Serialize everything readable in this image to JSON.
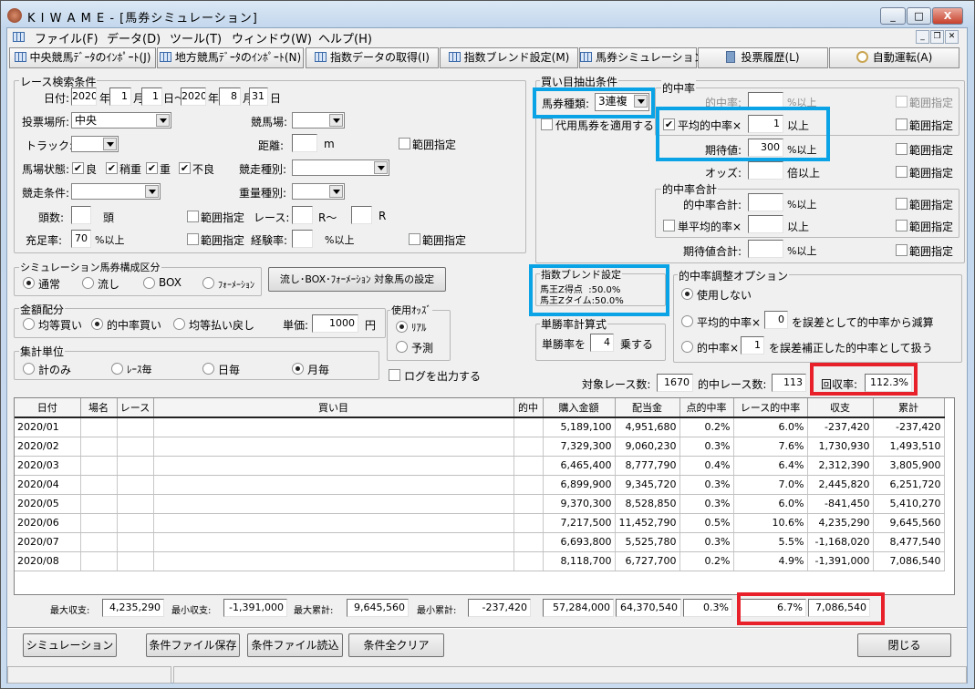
{
  "window": {
    "title": "K I W A M E - [馬券シミュレーション]",
    "controls": [
      "_",
      "□",
      "X"
    ]
  },
  "menu": [
    "ファイル(F)",
    "データ(D)",
    "ツール(T)",
    "ウィンドウ(W)",
    "ヘルプ(H)"
  ],
  "toolbar": [
    {
      "label": "中央競馬ﾃﾞｰﾀのｲﾝﾎﾟｰﾄ(J)",
      "icon": "grid-icon"
    },
    {
      "label": "地方競馬ﾃﾞｰﾀのｲﾝﾎﾟｰﾄ(N)",
      "icon": "grid-icon"
    },
    {
      "label": "指数データの取得(I)",
      "icon": "grid-icon"
    },
    {
      "label": "指数ブレンド設定(M)",
      "icon": "grid-icon"
    },
    {
      "label": "馬券シミュレーション(B)",
      "icon": "grid-icon"
    },
    {
      "label": "投票履歴(L)",
      "icon": "calculator-icon"
    },
    {
      "label": "自動運転(A)",
      "icon": "clock-icon"
    }
  ],
  "race": {
    "title": "レース検索条件",
    "date_label": "日付:",
    "from_year": "2020",
    "year": "年",
    "from_month": "1",
    "month": "月",
    "from_day": "1",
    "day_tilde": "日～",
    "to_year": "2020",
    "to_month": "8",
    "to_day": "31",
    "day": "日",
    "venue_label": "投票場所:",
    "venue": "中央",
    "track_label": "競馬場:",
    "track": "",
    "course_label": "トラック:",
    "distance_label": "距離:",
    "distance_unit": "m",
    "range": "範囲指定",
    "condition_label": "馬場状態:",
    "conditions": [
      {
        "label": "良",
        "checked": true
      },
      {
        "label": "稍重",
        "checked": true
      },
      {
        "label": "重",
        "checked": true
      },
      {
        "label": "不良",
        "checked": true
      }
    ],
    "race_type_label": "競走種別:",
    "race_cond_label": "競走条件:",
    "weight_label": "重量種別:",
    "heads_label": "頭数:",
    "heads_unit": "頭",
    "race_label": "レース:",
    "r_from": "R～",
    "r_to": "R",
    "fill_label": "充足率:",
    "fill": "70",
    "pct_over": "%以上",
    "exp_label": "経験率:"
  },
  "sim": {
    "title": "シミュレーション馬券構成区分",
    "options": [
      "通常",
      "流し",
      "BOX",
      "ﾌｫｰﾒｰｼｮﾝ"
    ],
    "selected": 0,
    "target_button": "流し･BOX･ﾌｫｰﾒｰｼｮﾝ 対象馬の設定"
  },
  "amount": {
    "title": "金額配分",
    "options": [
      "均等買い",
      "的中率買い",
      "均等払い戻し"
    ],
    "selected": 1,
    "unit_label": "単価:",
    "unit": "1000",
    "yen": "円"
  },
  "odds": {
    "title": "使用ｵｯｽﾞ",
    "options": [
      "ﾘｱﾙ",
      "予測"
    ],
    "selected": 0
  },
  "agg": {
    "title": "集計単位",
    "options": [
      "計のみ",
      "ﾚｰｽ毎",
      "日毎",
      "月毎"
    ],
    "selected": 3
  },
  "log_label": "ログを出力する",
  "pick": {
    "title": "買い目抽出条件",
    "ticket_label": "馬券種類:",
    "ticket": "3連複",
    "substitute": "代用馬券を適用する",
    "hit_group": "的中率",
    "hit_label": "的中率:",
    "pct_over": "%以上",
    "avg_hit": "平均的中率×",
    "avg_hit_value": "1",
    "over": "以上",
    "ev_label": "期待値:",
    "ev": "300",
    "odds_label": "オッズ:",
    "odds_unit": "倍以上",
    "range": "範囲指定",
    "total_group": "的中率合計",
    "hit_total": "的中率合計:",
    "single_avg": "単平均的率×",
    "ev_total": "期待値合計:"
  },
  "blend": {
    "title": "指数ブレンド設定",
    "lines": [
      "馬王Z得点  :50.0%",
      "馬王Zタイム:50.0%"
    ]
  },
  "win": {
    "title": "単勝率計算式",
    "pre": "単勝率を",
    "value": "4",
    "post": "乗する"
  },
  "adjust": {
    "title": "的中率調整オプション",
    "opt0": "使用しない",
    "opt1": "平均的中率×",
    "opt1_value": "0",
    "opt1_post": "を誤差として的中率から減算",
    "opt2": "的中率×",
    "opt2_value": "1",
    "opt2_post": "を誤差補正した的中率として扱う",
    "selected": 0
  },
  "stats": {
    "races_label": "対象レース数:",
    "races": "1670",
    "hits_label": "的中レース数:",
    "hits": "113",
    "return_label": "回収率:",
    "return": "112.3%"
  },
  "table": {
    "columns": [
      "日付",
      "場名",
      "レース",
      "買い目",
      "的中",
      "購入金額",
      "配当金",
      "点的中率",
      "レース的中率",
      "収支",
      "累計"
    ],
    "rows": [
      [
        "2020/01",
        "",
        "",
        "",
        "",
        "5,189,100",
        "4,951,680",
        "0.2%",
        "6.0%",
        "-237,420",
        "-237,420"
      ],
      [
        "2020/02",
        "",
        "",
        "",
        "",
        "7,329,300",
        "9,060,230",
        "0.3%",
        "7.6%",
        "1,730,930",
        "1,493,510"
      ],
      [
        "2020/03",
        "",
        "",
        "",
        "",
        "6,465,400",
        "8,777,790",
        "0.4%",
        "6.4%",
        "2,312,390",
        "3,805,900"
      ],
      [
        "2020/04",
        "",
        "",
        "",
        "",
        "6,899,900",
        "9,345,720",
        "0.3%",
        "7.0%",
        "2,445,820",
        "6,251,720"
      ],
      [
        "2020/05",
        "",
        "",
        "",
        "",
        "9,370,300",
        "8,528,850",
        "0.3%",
        "6.0%",
        "-841,450",
        "5,410,270"
      ],
      [
        "2020/06",
        "",
        "",
        "",
        "",
        "7,217,500",
        "11,452,790",
        "0.5%",
        "10.6%",
        "4,235,290",
        "9,645,560"
      ],
      [
        "2020/07",
        "",
        "",
        "",
        "",
        "6,693,800",
        "5,525,780",
        "0.3%",
        "5.5%",
        "-1,168,020",
        "8,477,540"
      ],
      [
        "2020/08",
        "",
        "",
        "",
        "",
        "8,118,700",
        "6,727,700",
        "0.2%",
        "4.9%",
        "-1,391,000",
        "7,086,540"
      ]
    ]
  },
  "summary": {
    "max_pl_label": "最大収支:",
    "max_pl": "4,235,290",
    "min_pl_label": "最小収支:",
    "min_pl": "-1,391,000",
    "max_cum_label": "最大累計:",
    "max_cum": "9,645,560",
    "min_cum_label": "最小累計:",
    "min_cum": "-237,420",
    "purchase": "57,284,000",
    "payout": "64,370,540",
    "point_hit": "0.3%",
    "race_hit": "6.7%",
    "total": "7,086,540"
  },
  "buttons": {
    "simulate": "シミュレーション",
    "save": "条件ファイル保存",
    "load": "条件ファイル読込",
    "clear": "条件全クリア",
    "close": "閉じる"
  },
  "colors": {
    "highlight_blue": "#0aa3e6",
    "highlight_red": "#e8202a"
  }
}
